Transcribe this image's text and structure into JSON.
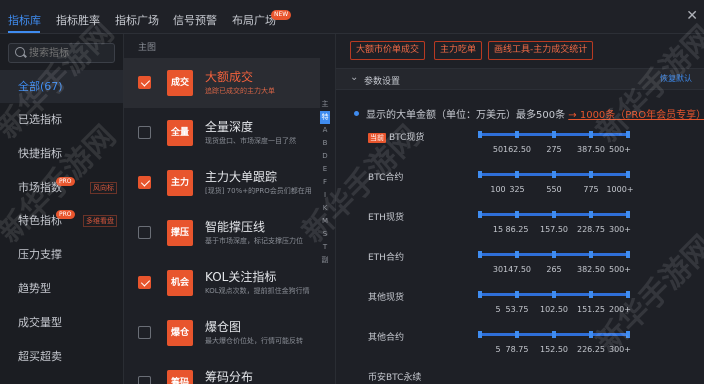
{
  "tabs": [
    {
      "label": "指标库",
      "active": true
    },
    {
      "label": "指标胜率",
      "active": false
    },
    {
      "label": "指标广场",
      "active": false
    },
    {
      "label": "信号预警",
      "active": false
    },
    {
      "label": "布局广场",
      "active": false,
      "badge": "NEW"
    }
  ],
  "search": {
    "placeholder": "搜索指标"
  },
  "sidebar": {
    "items": [
      {
        "label": "全部(67)",
        "active": true
      },
      {
        "label": "已选指标"
      },
      {
        "label": "快捷指标"
      },
      {
        "label": "市场指数",
        "pro": "PRO",
        "tag": "风向标"
      },
      {
        "label": "特色指标",
        "pro": "PRO",
        "tag": "多维看盘"
      },
      {
        "label": "压力支撑"
      },
      {
        "label": "趋势型"
      },
      {
        "label": "成交量型"
      },
      {
        "label": "超买超卖"
      }
    ]
  },
  "middle": {
    "section_label": "主图",
    "items": [
      {
        "icon": "成交",
        "title": "大额成交",
        "desc": "追踪已成交的主力大单",
        "checked": true,
        "active": true
      },
      {
        "icon": "全量",
        "title": "全量深度",
        "desc": "现货盘口、市场深度一目了然",
        "checked": false
      },
      {
        "icon": "主力",
        "title": "主力大单跟踪",
        "desc": "[现货] 70%+的PRO会员们都在用",
        "checked": true
      },
      {
        "icon": "撑压",
        "title": "智能撑压线",
        "desc": "基于市场深度，标记支撑压力位",
        "checked": false
      },
      {
        "icon": "机会",
        "title": "KOL关注指标",
        "desc": "KOL观点次数，提前抓住金狗行情",
        "checked": true
      },
      {
        "icon": "爆仓",
        "title": "爆仓图",
        "desc": "最大爆仓价位处，行情可能反转",
        "checked": false
      },
      {
        "icon": "筹码",
        "title": "筹码分布",
        "desc": "",
        "checked": false
      }
    ],
    "alpha_index": [
      "主",
      "特",
      "A",
      "B",
      "D",
      "E",
      "F",
      "I",
      "K",
      "M",
      "S",
      "T",
      "副"
    ]
  },
  "right": {
    "buttons": [
      "大额市价单成交",
      "主力吃单",
      "画线工具-主力成交统计"
    ],
    "section_title": "参数设置",
    "reset_label": "恢复默认",
    "desc_main": "显示的大单金额（单位：万美元）最多500条",
    "desc_link": "→ 1000条（PRO年会员专享）",
    "current_badge": "当前",
    "sliders": [
      {
        "label": "BTC现货",
        "current": true,
        "ticks": [
          "50",
          "162.50",
          "275",
          "387.50",
          "500+"
        ]
      },
      {
        "label": "BTC合约",
        "ticks": [
          "100",
          "325",
          "550",
          "775",
          "1000+"
        ]
      },
      {
        "label": "ETH现货",
        "ticks": [
          "15",
          "86.25",
          "157.50",
          "228.75",
          "300+"
        ]
      },
      {
        "label": "ETH合约",
        "ticks": [
          "30",
          "147.50",
          "265",
          "382.50",
          "500+"
        ]
      },
      {
        "label": "其他现货",
        "ticks": [
          "5",
          "53.75",
          "102.50",
          "151.25",
          "200+"
        ]
      },
      {
        "label": "其他合约",
        "ticks": [
          "5",
          "78.75",
          "152.50",
          "226.25",
          "300+"
        ]
      },
      {
        "label": "币安BTC永续",
        "ticks": []
      }
    ]
  },
  "watermark": "新华手游网",
  "colors": {
    "accent": "#3f8cf0",
    "brand": "#e8552d",
    "bg": "#1e2026"
  }
}
